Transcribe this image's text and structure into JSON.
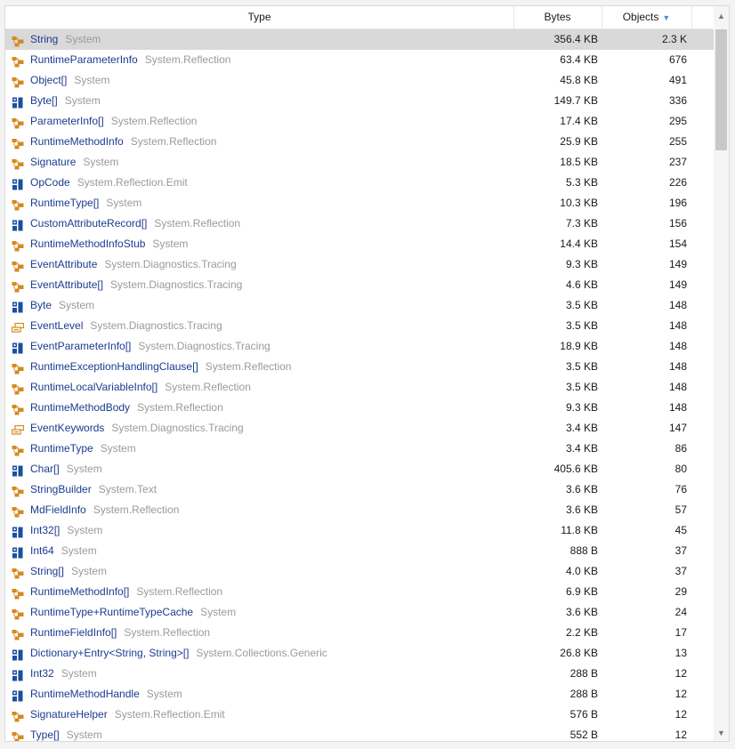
{
  "columns": {
    "type": "Type",
    "bytes": "Bytes",
    "objects": "Objects",
    "sort_indicator": "▼"
  },
  "colors": {
    "class_icon": "#d6891f",
    "struct_icon": "#1a4fa0",
    "enum_icon": "#d6891f",
    "type_name": "#1a3b8f",
    "namespace": "#9a9a9a",
    "selected_row": "#d9d9d9"
  },
  "scrollbar": {
    "up_arrow": "▲",
    "down_arrow": "▼"
  },
  "rows": [
    {
      "name": "String",
      "ns": "System",
      "bytes": "356.4 KB",
      "objects": "2.3 K",
      "icon": "class-icon",
      "selected": true
    },
    {
      "name": "RuntimeParameterInfo",
      "ns": "System.Reflection",
      "bytes": "63.4 KB",
      "objects": "676",
      "icon": "class-icon"
    },
    {
      "name": "Object[]",
      "ns": "System",
      "bytes": "45.8 KB",
      "objects": "491",
      "icon": "class-icon"
    },
    {
      "name": "Byte[]",
      "ns": "System",
      "bytes": "149.7 KB",
      "objects": "336",
      "icon": "struct-icon"
    },
    {
      "name": "ParameterInfo[]",
      "ns": "System.Reflection",
      "bytes": "17.4 KB",
      "objects": "295",
      "icon": "class-icon"
    },
    {
      "name": "RuntimeMethodInfo",
      "ns": "System.Reflection",
      "bytes": "25.9 KB",
      "objects": "255",
      "icon": "class-icon"
    },
    {
      "name": "Signature",
      "ns": "System",
      "bytes": "18.5 KB",
      "objects": "237",
      "icon": "class-icon"
    },
    {
      "name": "OpCode",
      "ns": "System.Reflection.Emit",
      "bytes": "5.3 KB",
      "objects": "226",
      "icon": "struct-icon"
    },
    {
      "name": "RuntimeType[]",
      "ns": "System",
      "bytes": "10.3 KB",
      "objects": "196",
      "icon": "class-icon"
    },
    {
      "name": "CustomAttributeRecord[]",
      "ns": "System.Reflection",
      "bytes": "7.3 KB",
      "objects": "156",
      "icon": "struct-icon"
    },
    {
      "name": "RuntimeMethodInfoStub",
      "ns": "System",
      "bytes": "14.4 KB",
      "objects": "154",
      "icon": "class-icon"
    },
    {
      "name": "EventAttribute",
      "ns": "System.Diagnostics.Tracing",
      "bytes": "9.3 KB",
      "objects": "149",
      "icon": "class-icon"
    },
    {
      "name": "EventAttribute[]",
      "ns": "System.Diagnostics.Tracing",
      "bytes": "4.6 KB",
      "objects": "149",
      "icon": "class-icon"
    },
    {
      "name": "Byte",
      "ns": "System",
      "bytes": "3.5 KB",
      "objects": "148",
      "icon": "struct-icon"
    },
    {
      "name": "EventLevel",
      "ns": "System.Diagnostics.Tracing",
      "bytes": "3.5 KB",
      "objects": "148",
      "icon": "enum-icon"
    },
    {
      "name": "EventParameterInfo[]",
      "ns": "System.Diagnostics.Tracing",
      "bytes": "18.9 KB",
      "objects": "148",
      "icon": "struct-icon"
    },
    {
      "name": "RuntimeExceptionHandlingClause[]",
      "ns": "System.Reflection",
      "bytes": "3.5 KB",
      "objects": "148",
      "icon": "class-icon"
    },
    {
      "name": "RuntimeLocalVariableInfo[]",
      "ns": "System.Reflection",
      "bytes": "3.5 KB",
      "objects": "148",
      "icon": "class-icon"
    },
    {
      "name": "RuntimeMethodBody",
      "ns": "System.Reflection",
      "bytes": "9.3 KB",
      "objects": "148",
      "icon": "class-icon"
    },
    {
      "name": "EventKeywords",
      "ns": "System.Diagnostics.Tracing",
      "bytes": "3.4 KB",
      "objects": "147",
      "icon": "enum-icon"
    },
    {
      "name": "RuntimeType",
      "ns": "System",
      "bytes": "3.4 KB",
      "objects": "86",
      "icon": "class-icon"
    },
    {
      "name": "Char[]",
      "ns": "System",
      "bytes": "405.6 KB",
      "objects": "80",
      "icon": "struct-icon"
    },
    {
      "name": "StringBuilder",
      "ns": "System.Text",
      "bytes": "3.6 KB",
      "objects": "76",
      "icon": "class-icon"
    },
    {
      "name": "MdFieldInfo",
      "ns": "System.Reflection",
      "bytes": "3.6 KB",
      "objects": "57",
      "icon": "class-icon"
    },
    {
      "name": "Int32[]",
      "ns": "System",
      "bytes": "11.8 KB",
      "objects": "45",
      "icon": "struct-icon"
    },
    {
      "name": "Int64",
      "ns": "System",
      "bytes": "888 B",
      "objects": "37",
      "icon": "struct-icon"
    },
    {
      "name": "String[]",
      "ns": "System",
      "bytes": "4.0 KB",
      "objects": "37",
      "icon": "class-icon"
    },
    {
      "name": "RuntimeMethodInfo[]",
      "ns": "System.Reflection",
      "bytes": "6.9 KB",
      "objects": "29",
      "icon": "class-icon"
    },
    {
      "name": "RuntimeType+RuntimeTypeCache",
      "ns": "System",
      "bytes": "3.6 KB",
      "objects": "24",
      "icon": "class-icon"
    },
    {
      "name": "RuntimeFieldInfo[]",
      "ns": "System.Reflection",
      "bytes": "2.2 KB",
      "objects": "17",
      "icon": "class-icon"
    },
    {
      "name": "Dictionary+Entry<String, String>[]",
      "ns": "System.Collections.Generic",
      "bytes": "26.8 KB",
      "objects": "13",
      "icon": "struct-icon"
    },
    {
      "name": "Int32",
      "ns": "System",
      "bytes": "288 B",
      "objects": "12",
      "icon": "struct-icon"
    },
    {
      "name": "RuntimeMethodHandle",
      "ns": "System",
      "bytes": "288 B",
      "objects": "12",
      "icon": "struct-icon"
    },
    {
      "name": "SignatureHelper",
      "ns": "System.Reflection.Emit",
      "bytes": "576 B",
      "objects": "12",
      "icon": "class-icon"
    },
    {
      "name": "Type[]",
      "ns": "System",
      "bytes": "552 B",
      "objects": "12",
      "icon": "class-icon"
    }
  ]
}
